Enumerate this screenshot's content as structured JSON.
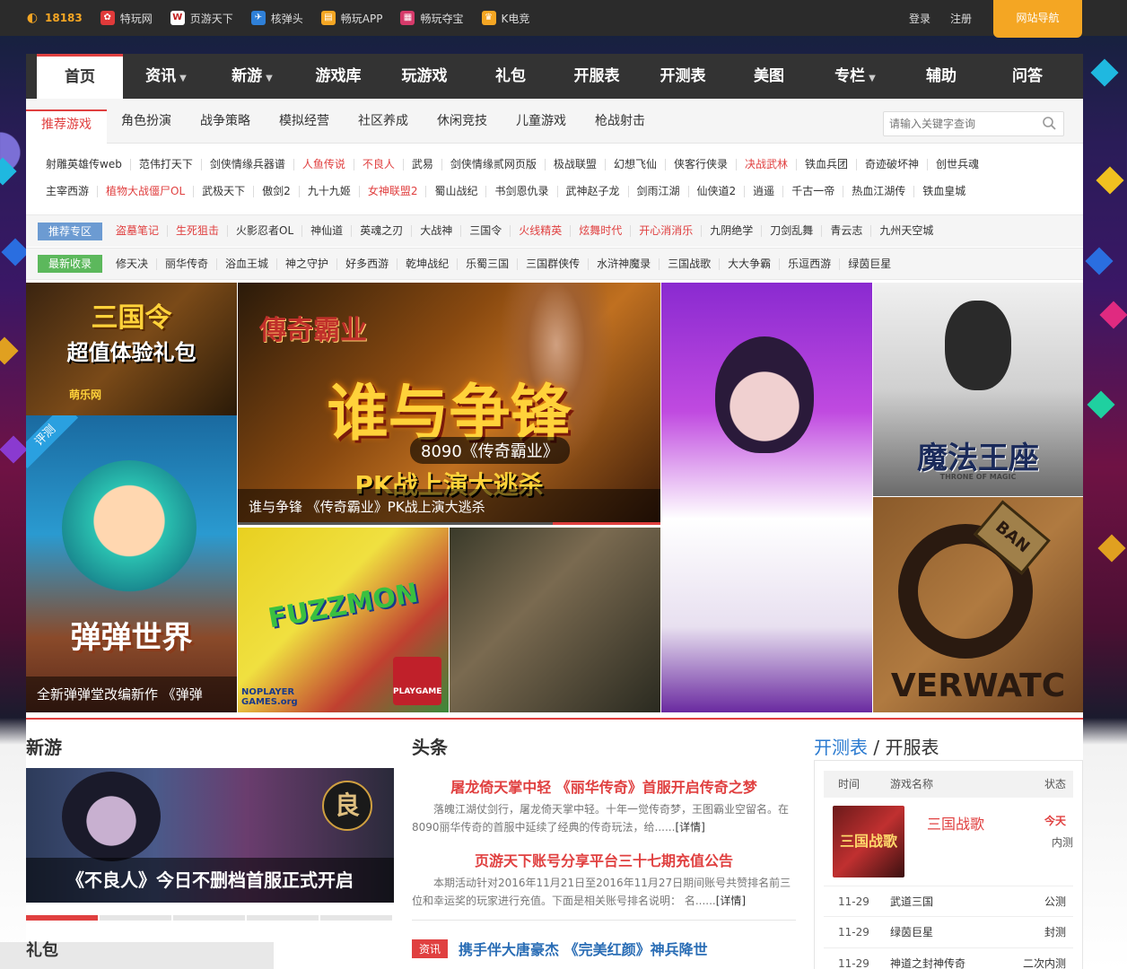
{
  "topbar": {
    "links": [
      {
        "label": "18183",
        "icon": "18183-logo-icon",
        "color": "#f4a623"
      },
      {
        "label": "特玩网",
        "icon": "tewan-icon",
        "color": "#e03a3a"
      },
      {
        "label": "页游天下",
        "icon": "webgame-icon",
        "color": "#c01c1c"
      },
      {
        "label": "核弹头",
        "icon": "nuke-icon",
        "color": "#2f80d8"
      },
      {
        "label": "畅玩APP",
        "icon": "app-icon",
        "color": "#f4a623"
      },
      {
        "label": "畅玩夺宝",
        "icon": "treasure-icon",
        "color": "#d63a6a"
      },
      {
        "label": "K电竞",
        "icon": "trophy-icon",
        "color": "#f4a623"
      }
    ],
    "login": "登录",
    "register": "注册",
    "site_nav": "网站导航"
  },
  "main_nav": [
    {
      "label": "首页",
      "active": true
    },
    {
      "label": "资讯",
      "dropdown": true
    },
    {
      "label": "新游",
      "dropdown": true
    },
    {
      "label": "游戏库"
    },
    {
      "label": "玩游戏"
    },
    {
      "label": "礼包"
    },
    {
      "label": "开服表"
    },
    {
      "label": "开测表"
    },
    {
      "label": "美图"
    },
    {
      "label": "专栏",
      "dropdown": true
    },
    {
      "label": "辅助"
    },
    {
      "label": "问答"
    }
  ],
  "sub_nav": {
    "tabs": [
      "推荐游戏",
      "角色扮演",
      "战争策略",
      "模拟经营",
      "社区养成",
      "休闲竞技",
      "儿童游戏",
      "枪战射击"
    ],
    "search_placeholder": "请输入关键字查询"
  },
  "game_rows": [
    [
      {
        "t": "射雕英雄传web"
      },
      {
        "t": "范伟打天下"
      },
      {
        "t": "剑侠情缘兵器谱"
      },
      {
        "t": "人鱼传说",
        "red": true
      },
      {
        "t": "不良人",
        "red": true
      },
      {
        "t": "武易"
      },
      {
        "t": "剑侠情缘贰网页版"
      },
      {
        "t": "极战联盟"
      },
      {
        "t": "幻想飞仙"
      },
      {
        "t": "侠客行侠录"
      },
      {
        "t": "决战武林",
        "red": true
      },
      {
        "t": "铁血兵团"
      },
      {
        "t": "奇迹破坏神"
      },
      {
        "t": "创世兵魂"
      }
    ],
    [
      {
        "t": "主宰西游"
      },
      {
        "t": "植物大战僵尸OL",
        "red": true
      },
      {
        "t": "武极天下"
      },
      {
        "t": "傲剑2"
      },
      {
        "t": "九十九姬"
      },
      {
        "t": "女神联盟2",
        "red": true
      },
      {
        "t": "蜀山战纪"
      },
      {
        "t": "书剑恩仇录"
      },
      {
        "t": "武神赵子龙"
      },
      {
        "t": "剑雨江湖"
      },
      {
        "t": "仙侠道2"
      },
      {
        "t": "逍遥"
      },
      {
        "t": "千古一帝"
      },
      {
        "t": "热血江湖传"
      },
      {
        "t": "铁血皇城"
      }
    ]
  ],
  "zones": {
    "badge": "推荐专区",
    "badge_color": "#6c9bd2",
    "items": [
      {
        "t": "盗墓笔记",
        "red": true
      },
      {
        "t": "生死狙击",
        "red": true
      },
      {
        "t": "火影忍者OL"
      },
      {
        "t": "神仙道"
      },
      {
        "t": "英魂之刃"
      },
      {
        "t": "大战神"
      },
      {
        "t": "三国令"
      },
      {
        "t": "火线精英",
        "red": true
      },
      {
        "t": "炫舞时代",
        "red": true
      },
      {
        "t": "开心消消乐",
        "red": true
      },
      {
        "t": "九阴绝学"
      },
      {
        "t": "刀剑乱舞"
      },
      {
        "t": "青云志"
      },
      {
        "t": "九州天空城"
      }
    ]
  },
  "recent": {
    "badge": "最新收录",
    "badge_color": "#5cb85c",
    "items": [
      {
        "t": "修天决"
      },
      {
        "t": "丽华传奇"
      },
      {
        "t": "浴血王城"
      },
      {
        "t": "神之守护"
      },
      {
        "t": "好多西游"
      },
      {
        "t": "乾坤战纪"
      },
      {
        "t": "乐蜀三国"
      },
      {
        "t": "三国群侠传"
      },
      {
        "t": "水浒神魔录"
      },
      {
        "t": "三国战歌"
      },
      {
        "t": "大大争霸"
      },
      {
        "t": "乐逗西游"
      },
      {
        "t": "绿茵巨星"
      }
    ]
  },
  "mosaic": {
    "t1_title": "三国令",
    "t1_sub": "超值体验礼包",
    "t1_logo": "萌乐网",
    "t2_badge": "评测",
    "t2_title": "弹弹世界",
    "t2_caption": "全新弹弹堂改编新作 《弹弹",
    "main_logo": "傳奇霸业",
    "main_big": "谁与争锋",
    "main_sub": "8090《传奇霸业》",
    "main_pk": "PK战上演大逃杀",
    "main_caption": "谁与争锋 《传奇霸业》PK战上演大逃杀",
    "fuzzmon_title": "FUZZMON",
    "fuzzmon_tag": "PLAYGAME",
    "fuzzmon_site": "NOPLAYER GAMES.org",
    "magic_title": "魔法王座",
    "magic_sub": "THRONE OF MAGIC",
    "ow_text": "VERWATC",
    "ow_ban": "BAN"
  },
  "sections": {
    "newgame": "新游",
    "headline": "头条",
    "kaice_a": "开测表",
    "kaice_sep": " / ",
    "kaice_b": "开服表",
    "gift": "礼包"
  },
  "newgame": {
    "caption": "《不良人》今日不删档首服正式开启",
    "logo": "良"
  },
  "news": [
    {
      "title": "屠龙倚天掌中轻 《丽华传奇》首服开启传奇之梦",
      "desc": "落魄江湖仗剑行，屠龙倚天掌中轻。十年一觉传奇梦，王图霸业空留名。在8090丽华传奇的首服中延续了经典的传奇玩法，给......",
      "more": "[详情]"
    },
    {
      "title": "页游天下账号分享平台三十七期充值公告",
      "desc": "本期活动针对2016年11月21日至2016年11月27日期间账号共赞排名前三位和幸运奖的玩家进行充值。下面是相关账号排名说明： 名......",
      "more": "[详情]"
    }
  ],
  "news_item": {
    "tag": "资讯",
    "title": "携手伴大唐豪杰 《完美红颜》神兵降世"
  },
  "kaice": {
    "headers": [
      "时间",
      "游戏名称",
      "状态"
    ],
    "featured": {
      "name": "三国战歌",
      "when": "今天",
      "status": "内测",
      "cover": "三国战歌"
    },
    "rows": [
      {
        "date": "11-29",
        "name": "武道三国",
        "status": "公测"
      },
      {
        "date": "11-29",
        "name": "绿茵巨星",
        "status": "封测"
      },
      {
        "date": "11-29",
        "name": "神道之封神传奇",
        "status": "二次内测"
      }
    ]
  }
}
